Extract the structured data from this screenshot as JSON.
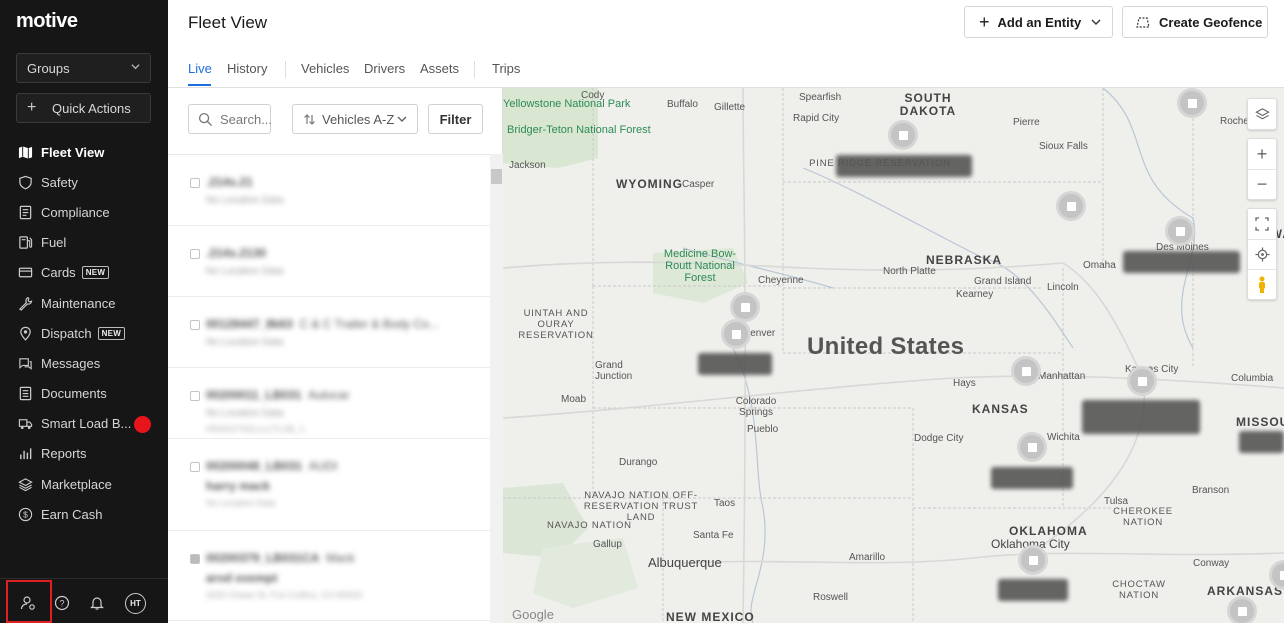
{
  "app": {
    "logo": "motive"
  },
  "sidebar": {
    "groups_label": "Groups",
    "quick_actions_label": "Quick Actions",
    "items": [
      {
        "label": "Fleet View",
        "icon": "map-icon",
        "active": true
      },
      {
        "label": "Safety",
        "icon": "shield-icon"
      },
      {
        "label": "Compliance",
        "icon": "document-icon"
      },
      {
        "label": "Fuel",
        "icon": "fuel-icon"
      },
      {
        "label": "Cards",
        "icon": "card-icon",
        "badge": "NEW"
      },
      {
        "label": "Maintenance",
        "icon": "wrench-icon"
      },
      {
        "label": "Dispatch",
        "icon": "location-icon",
        "badge": "NEW"
      },
      {
        "label": "Messages",
        "icon": "chat-icon"
      },
      {
        "label": "Documents",
        "icon": "file-icon"
      },
      {
        "label": "Smart Load B...",
        "icon": "truck-icon"
      },
      {
        "label": "Reports",
        "icon": "chart-icon"
      },
      {
        "label": "Marketplace",
        "icon": "layers-icon"
      },
      {
        "label": "Earn Cash",
        "icon": "dollar-icon"
      }
    ],
    "footer": {
      "avatar_initials": "HT"
    }
  },
  "header": {
    "title": "Fleet View",
    "add_entity_label": "Add an Entity",
    "create_geofence_label": "Create Geofence",
    "tabs": [
      "Live",
      "History",
      "Vehicles",
      "Drivers",
      "Assets",
      "Trips"
    ]
  },
  "list_panel": {
    "search_placeholder": "Search...",
    "sort_label": "Vehicles A-Z",
    "filter_label": "Filter",
    "rows": [
      {
        "id": ".214s.21",
        "sub": "No Location Data",
        "extra": ""
      },
      {
        "id": ".214s.2130",
        "sub": "No Location Data",
        "extra": ""
      },
      {
        "id": "00128447_8k63",
        "model": "C & C Trailer & Body Co...",
        "sub": "No Location Data",
        "extra": ""
      },
      {
        "id": "00200011_LB031",
        "model": "Autocar",
        "sub": "No Location Data",
        "extra": "#9000270SLLLLTLUB_1"
      },
      {
        "id": "00200048_LB031",
        "model": "AUDI",
        "sub": "harry mack",
        "extra": "No Location Data"
      },
      {
        "id": "00200379_LB031CA",
        "model": "Mack",
        "sub": "arod exempt",
        "extra": "2620 Chase St, Fort Collins, CO 80525"
      }
    ]
  },
  "map": {
    "country_label": "United States",
    "states": [
      "SOUTH DAKOTA",
      "WYOMING",
      "NEBRASKA",
      "KANSAS",
      "OKLAHOMA",
      "NEW MEXICO",
      "IOWA",
      "MISSOURI",
      "ARKANSAS"
    ],
    "cities": [
      "Cody",
      "Buffalo",
      "Gillette",
      "Spearfish",
      "Rapid City",
      "Pierre",
      "Sioux Falls",
      "Rochester",
      "Jackson",
      "Casper",
      "Cheyenne",
      "North Platte",
      "Grand Island",
      "Kearney",
      "Lincoln",
      "Omaha",
      "Des Moines",
      "Denver",
      "Grand Junction",
      "Moab",
      "Colorado Springs",
      "Pueblo",
      "Hays",
      "Manhattan",
      "Kansas City",
      "Columbia",
      "Dodge City",
      "Wichita",
      "Durango",
      "Taos",
      "Santa Fe",
      "Gallup",
      "Albuquerque",
      "Amarillo",
      "Oklahoma City",
      "Tulsa",
      "Branson",
      "Conway",
      "Roswell"
    ],
    "parks": [
      "Yellowstone National Park",
      "Bridger-Teton National Forest",
      "Medicine Bow-Routt National Forest"
    ],
    "reservations": [
      "PINE RIDGE RESERVATION",
      "UINTAH AND OURAY RESERVATION",
      "NAVAJO NATION OFF-RESERVATION TRUST LAND",
      "NAVAJO NATION",
      "CHEROKEE NATION",
      "CHOCTAW NATION"
    ],
    "footer_brand": "Google",
    "controls": [
      "layers-icon",
      "zoom-in-icon",
      "zoom-out-icon",
      "fullscreen-icon",
      "locate-icon",
      "pegman-icon"
    ]
  },
  "colors": {
    "sidebar_bg": "#161616",
    "accent": "#1d6fe0",
    "alert_dot": "#e8141c",
    "map_bg": "#efefeb"
  }
}
